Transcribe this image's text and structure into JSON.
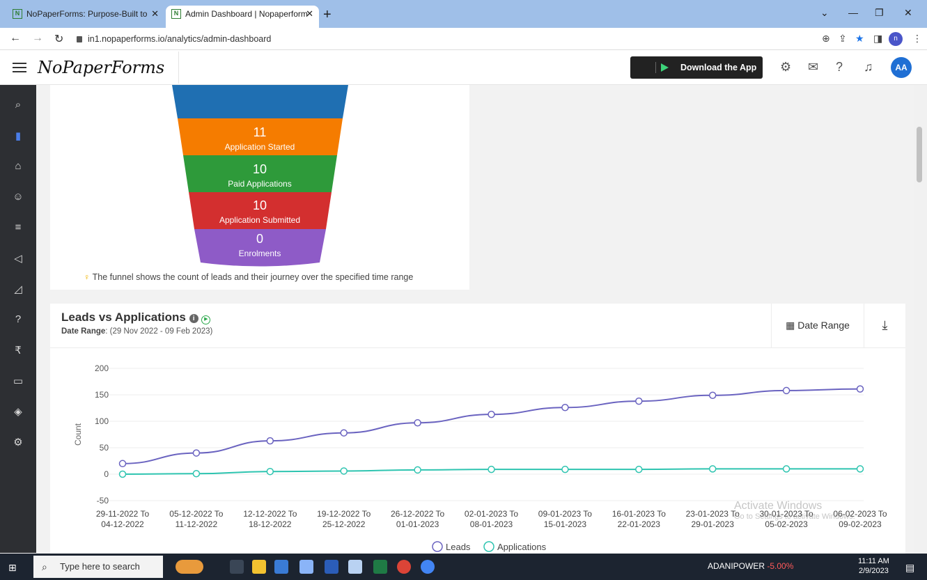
{
  "browser": {
    "tabs": [
      {
        "title": "NoPaperForms: Purpose-Built to",
        "active": false
      },
      {
        "title": "Admin Dashboard | Nopaperform",
        "active": true
      }
    ],
    "new_tab": "+",
    "url": "in1.nopaperforms.io/analytics/admin-dashboard",
    "profile_letter": "n"
  },
  "header": {
    "logo": "NoPaperForms",
    "download_label": "Download the App",
    "avatar": "AA"
  },
  "funnel": {
    "stages": [
      {
        "count": "11",
        "label": "Application Started",
        "color": "#f57c00"
      },
      {
        "count": "10",
        "label": "Paid Applications",
        "color": "#2e9a3a"
      },
      {
        "count": "10",
        "label": "Application Submitted",
        "color": "#d32f2f"
      },
      {
        "count": "0",
        "label": "Enrolments",
        "color": "#8e5bc7"
      }
    ],
    "top_color": "#1f6fb2",
    "note": "The funnel shows the count of leads and their journey over the specified time range"
  },
  "chart_header": {
    "title": "Leads vs Applications",
    "date_range_label": "Date Range",
    "date_range_value": ": (29 Nov 2022 - 09 Feb 2023)",
    "date_range_button": "Date Range"
  },
  "chart_data": {
    "type": "line",
    "ylabel": "Count",
    "xlabel": "",
    "ylim": [
      -50,
      200
    ],
    "yticks": [
      200,
      150,
      100,
      50,
      0,
      -50
    ],
    "grid": true,
    "legend_position": "bottom",
    "categories": [
      [
        "29-11-2022 To",
        "04-12-2022"
      ],
      [
        "05-12-2022 To",
        "11-12-2022"
      ],
      [
        "12-12-2022 To",
        "18-12-2022"
      ],
      [
        "19-12-2022 To",
        "25-12-2022"
      ],
      [
        "26-12-2022 To",
        "01-01-2023"
      ],
      [
        "02-01-2023 To",
        "08-01-2023"
      ],
      [
        "09-01-2023 To",
        "15-01-2023"
      ],
      [
        "16-01-2023 To",
        "22-01-2023"
      ],
      [
        "23-01-2023 To",
        "29-01-2023"
      ],
      [
        "30-01-2023 To",
        "05-02-2023"
      ],
      [
        "06-02-2023 To",
        "09-02-2023"
      ]
    ],
    "series": [
      {
        "name": "Leads",
        "color": "#6a63c0",
        "values": [
          20,
          40,
          63,
          78,
          97,
          113,
          126,
          138,
          149,
          158,
          161
        ]
      },
      {
        "name": "Applications",
        "color": "#2ec4b0",
        "values": [
          0,
          1,
          5,
          6,
          8,
          9,
          9,
          9,
          10,
          10,
          10
        ]
      }
    ]
  },
  "watermark": {
    "line1": "Activate Windows",
    "line2": "Go to Settings to activate Windows."
  },
  "taskbar": {
    "search_placeholder": "Type here to search",
    "stock_name": "ADANIPOWER",
    "stock_change": "-5.00%",
    "time": "11:11 AM",
    "date": "2/9/2023"
  }
}
